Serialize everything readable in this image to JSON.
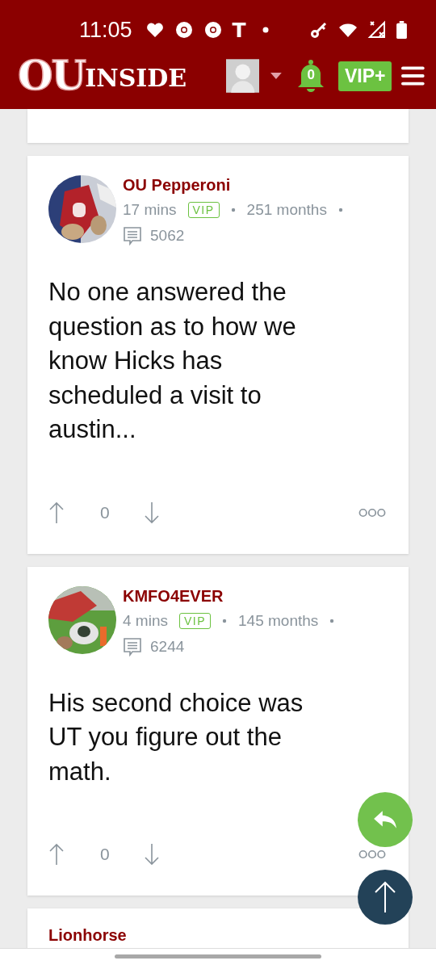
{
  "status_bar": {
    "time": "11:05",
    "notification_glyph": "T"
  },
  "header": {
    "logo_initials": "OU",
    "logo_word": "INSIDE",
    "notification_count": "0",
    "vip_button": "VIP+"
  },
  "posts": [
    {
      "author": "OU Pepperoni",
      "time": "17 mins",
      "badge": "VIP",
      "tenure": "251 months",
      "comments": "5062",
      "body": "No one answered the question as to how we know Hicks has scheduled a visit to austin...",
      "score": "0"
    },
    {
      "author": "KMFO4EVER",
      "time": "4 mins",
      "badge": "VIP",
      "tenure": "145 months",
      "comments": "6244",
      "body": "His second choice was UT you figure out the math.",
      "score": "0"
    }
  ],
  "next_post": {
    "author": "Lionhorse"
  }
}
